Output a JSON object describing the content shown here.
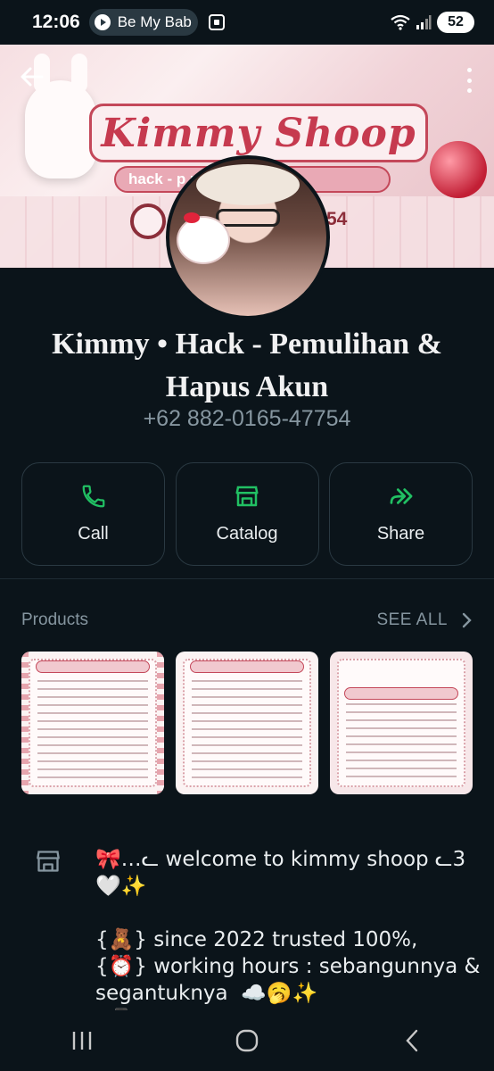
{
  "status_bar": {
    "time": "12:06",
    "media_title": "Be My Bab",
    "battery": "52"
  },
  "cover": {
    "banner_title": "Kimmy Shoop",
    "banner_subtitle": "hack - p          pus akun",
    "phone_fragment": "54"
  },
  "profile": {
    "name": "Kimmy • Hack - Pemulihan & Hapus Akun",
    "phone": "+62 882-0165-47754"
  },
  "actions": [
    {
      "label": "Call",
      "icon": "phone-icon"
    },
    {
      "label": "Catalog",
      "icon": "storefront-icon"
    },
    {
      "label": "Share",
      "icon": "share-forward-icon"
    }
  ],
  "products": {
    "title": "Products",
    "see_all": "SEE ALL"
  },
  "description": "🎀…ᓚ welcome to kimmy shoop ᓚ3🤍✨\n\n{🧸} since 2022 trusted 100%,\n{⏰} working hours : sebangunnya & segantuknya  ☁️🥱✨\n{📱} fast respons",
  "colors": {
    "background": "#0b141a",
    "accent_green": "#21c063",
    "muted_text": "#8696a0",
    "border": "#2a3942"
  }
}
